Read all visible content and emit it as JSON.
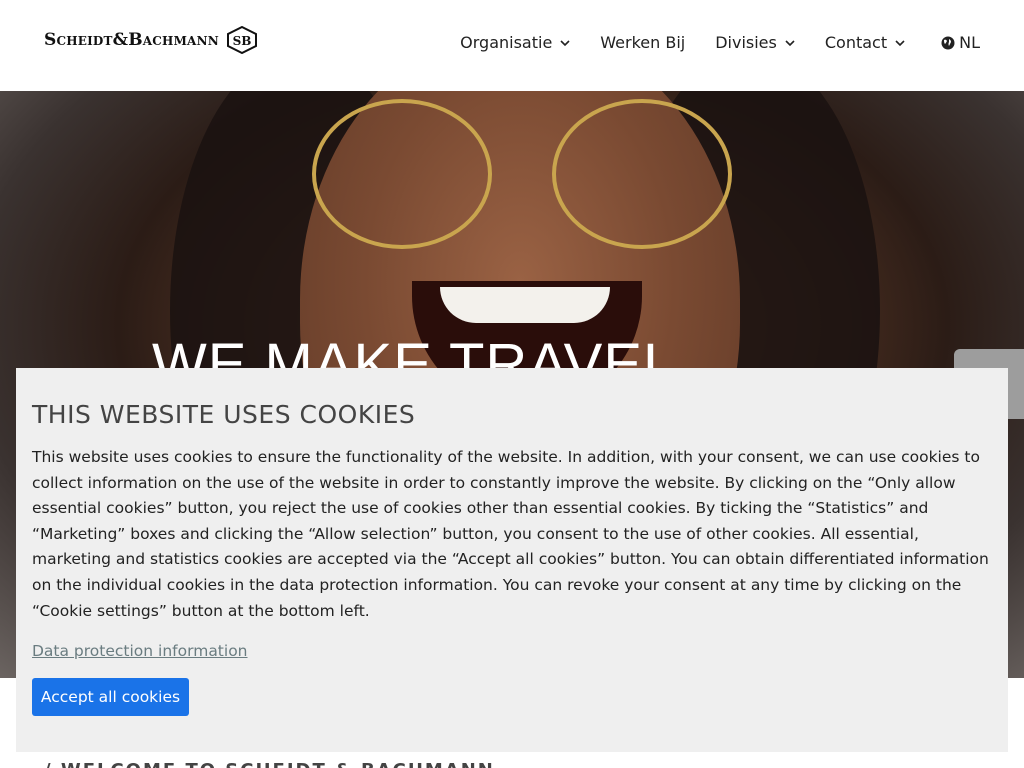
{
  "header": {
    "logo_text": "Scheidt&Bachmann",
    "logo_mark": "SB",
    "nav": [
      {
        "label": "Organisatie",
        "has_dropdown": true
      },
      {
        "label": "Werken Bij",
        "has_dropdown": false
      },
      {
        "label": "Divisies",
        "has_dropdown": true
      },
      {
        "label": "Contact",
        "has_dropdown": true
      }
    ],
    "language": "NL"
  },
  "hero": {
    "title": "WE MAKE TRAVEL"
  },
  "cookie_banner": {
    "title": "THIS WEBSITE USES COOKIES",
    "body": "This website uses cookies to ensure the functionality of the website. In addition, with your consent, we can use cookies to collect information on the use of the website in order to constantly improve the website. By clicking on the “Only allow essential cookies” button, you reject the use of cookies other than essential cookies. By ticking the “Statistics” and “Marketing” boxes and clicking the “Allow selection” button, you consent to the use of other cookies. All essential, marketing and statistics cookies are accepted via the “Accept all cookies” button. You can obtain differentiated information on the individual cookies in the data protection information. You can revoke your consent at any time by clicking on the “Cookie settings” button at the bottom left.",
    "link_label": "Data protection information",
    "accept_label": "Accept all cookies"
  },
  "content": {
    "welcome": "/ WELCOME TO SCHEIDT & BACHMANN"
  },
  "colors": {
    "accent_button": "#1a73e8",
    "banner_bg": "#efefef"
  }
}
